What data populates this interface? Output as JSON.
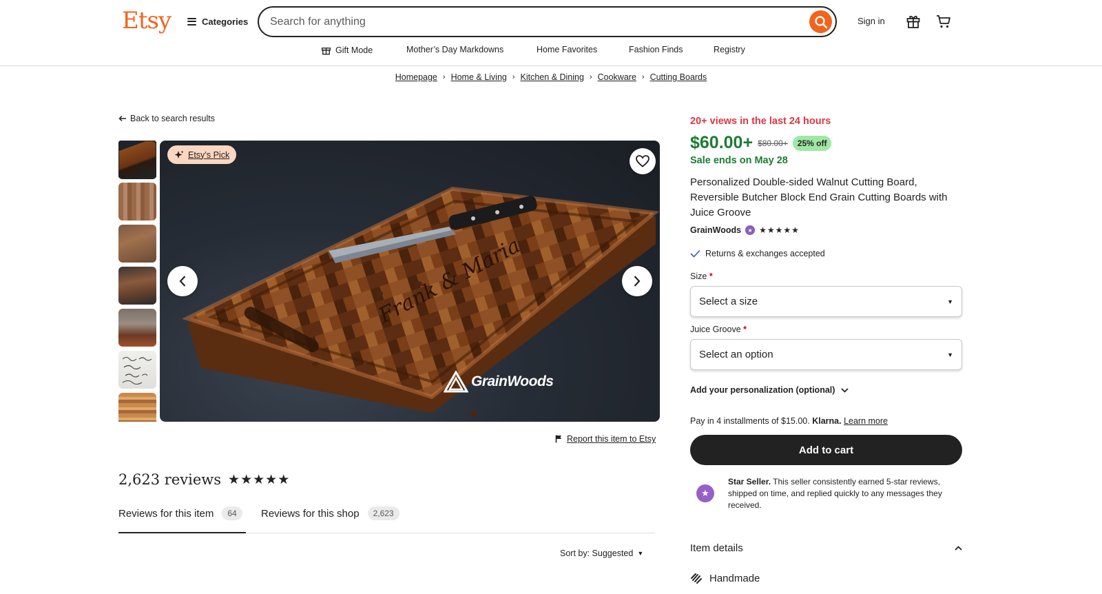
{
  "header": {
    "logo": "Etsy",
    "categories_label": "Categories",
    "search_placeholder": "Search for anything",
    "signin_label": "Sign in"
  },
  "subnav": [
    "Gift Mode",
    "Mother’s Day Markdowns",
    "Home Favorites",
    "Fashion Finds",
    "Registry"
  ],
  "breadcrumb": [
    "Homepage",
    "Home & Living",
    "Kitchen & Dining",
    "Cookware",
    "Cutting Boards"
  ],
  "gallery": {
    "back_label": "Back to search results",
    "badge_label": "Etsy’s Pick",
    "brand_watermark": "GrainWoods",
    "engraving": "Frank & Maria",
    "thumb_count": 7
  },
  "report_label": "Report this item to Etsy",
  "reviews": {
    "count_text": "2,623 reviews",
    "rating_stars": 5,
    "tabs": [
      {
        "label": "Reviews for this item",
        "count": "64"
      },
      {
        "label": "Reviews for this shop",
        "count": "2,623"
      }
    ],
    "sort_label": "Sort by: Suggested"
  },
  "product": {
    "views_text": "20+ views in the last 24 hours",
    "price": "$60.00+",
    "original_price": "$80.00+",
    "discount": "25% off",
    "sale_ends": "Sale ends on May 28",
    "title": "Personalized Double-sided Walnut Cutting Board, Reversible Butcher Block End Grain Cutting Boards with Juice Groove",
    "shop_name": "GrainWoods",
    "shop_rating_stars": 5,
    "returns_text": "Returns & exchanges accepted",
    "size_label": "Size",
    "size_value": "Select a size",
    "groove_label": "Juice Groove",
    "groove_value": "Select an option",
    "required_mark": "*",
    "personalization_label": "Add your personalization (optional)",
    "klarna_text": "Pay in 4 installments of $15.00.",
    "klarna_brand": "Klarna.",
    "klarna_learn": "Learn more",
    "add_to_cart": "Add to cart",
    "star_seller_title": "Star Seller.",
    "star_seller_text": "This seller consistently earned 5-star reviews, shipped on time, and replied quickly to any messages they received.",
    "item_details_label": "Item details",
    "handmade_label": "Handmade"
  },
  "colors": {
    "brand": "#f1641e",
    "sale_green": "#1b7d33",
    "views_red": "#dc3545",
    "discount_bg": "#9ee8a3",
    "star_seller_purple": "#9560c7"
  }
}
